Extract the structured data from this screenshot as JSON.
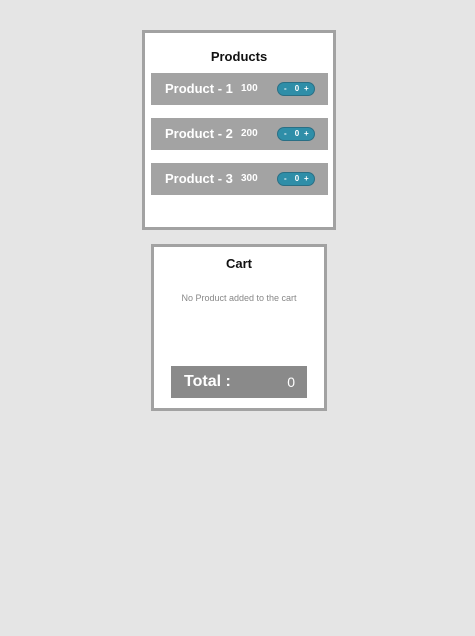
{
  "products": {
    "title": "Products",
    "items": [
      {
        "name": "Product - 1",
        "price": "100",
        "qty": "0",
        "minus": "-",
        "plus": "+"
      },
      {
        "name": "Product - 2",
        "price": "200",
        "qty": "0",
        "minus": "-",
        "plus": "+"
      },
      {
        "name": "Product - 3",
        "price": "300",
        "qty": "0",
        "minus": "-",
        "plus": "+"
      }
    ]
  },
  "cart": {
    "title": "Cart",
    "empty_message": "No Product added to the cart",
    "total_label": "Total :",
    "total_value": "0"
  },
  "colors": {
    "background": "#e5e5e5",
    "panel_border": "#a2a2a2",
    "product_row": "#a3a3a3",
    "qty_pill": "#2f8ea8",
    "total_bar": "#8a8a8a"
  }
}
